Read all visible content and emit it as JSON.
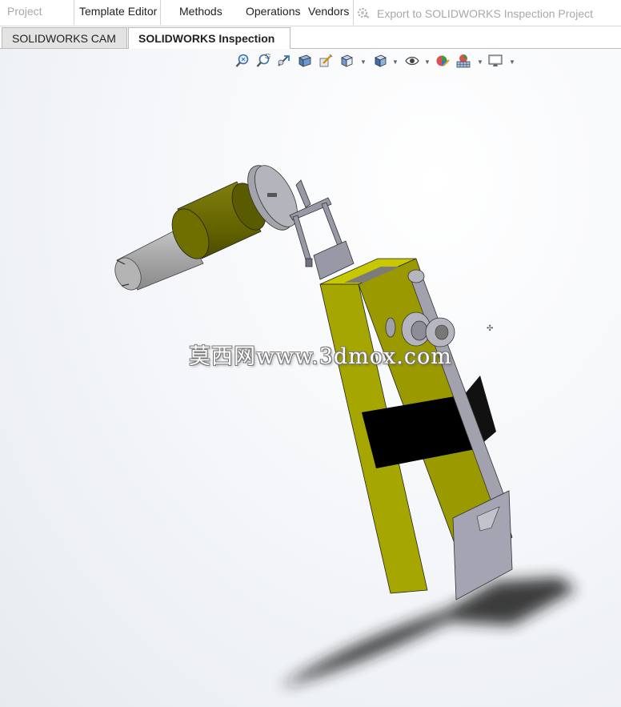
{
  "ribbon": {
    "items": [
      {
        "label": "Project",
        "disabled": true
      },
      {
        "label": "Template Editor",
        "disabled": false
      },
      {
        "label": "Methods",
        "disabled": false
      },
      {
        "label": "Operations",
        "disabled": false
      },
      {
        "label": "Vendors",
        "disabled": false
      },
      {
        "label": "Export to SOLIDWORKS Inspection Project",
        "disabled": true
      }
    ],
    "export_icon": "export-gear-icon"
  },
  "tabs": [
    {
      "label": "SOLIDWORKS CAM",
      "active": false
    },
    {
      "label": "SOLIDWORKS Inspection",
      "active": true
    }
  ],
  "heads_up_toolbar": [
    {
      "icon": "zoom-to-fit-icon"
    },
    {
      "icon": "zoom-to-area-icon"
    },
    {
      "icon": "previous-view-icon"
    },
    {
      "icon": "section-view-icon"
    },
    {
      "icon": "dynamic-annotation-icon"
    },
    {
      "icon": "view-orientation-icon",
      "dropdown": true
    },
    {
      "icon": "display-style-icon",
      "dropdown": true
    },
    {
      "icon": "hide-show-items-icon",
      "dropdown": true
    },
    {
      "icon": "edit-appearance-icon"
    },
    {
      "icon": "apply-scene-icon",
      "dropdown": true
    },
    {
      "icon": "view-settings-icon",
      "dropdown": true
    }
  ],
  "viewport": {
    "watermark": "莫西网www.3dmox.com",
    "colors": {
      "body_yellow": "#a8a800",
      "band_black": "#000000",
      "motor_grey": "#a9a9a9",
      "motor_olive": "#6b6b00",
      "part_grey": "#a4a4b0",
      "shadow": "#222222"
    }
  }
}
